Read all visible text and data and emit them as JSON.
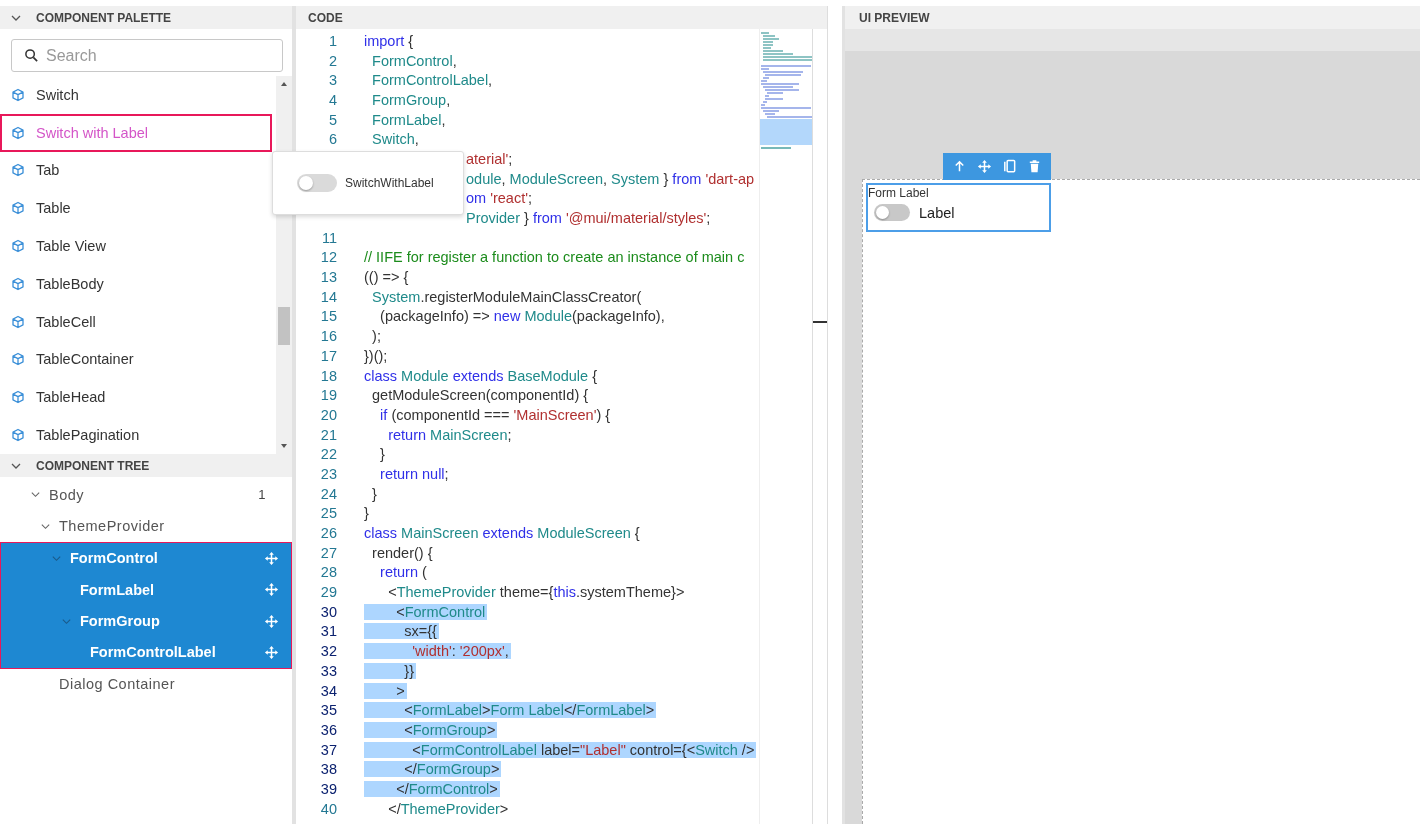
{
  "palette": {
    "title": "COMPONENT PALETTE",
    "expanded": true,
    "search": {
      "placeholder": "Search"
    },
    "items": [
      {
        "label": "Switch",
        "selected": false
      },
      {
        "label": "Switch with Label",
        "selected": true
      },
      {
        "label": "Tab",
        "selected": false
      },
      {
        "label": "Table",
        "selected": false
      },
      {
        "label": "Table View",
        "selected": false
      },
      {
        "label": "TableBody",
        "selected": false
      },
      {
        "label": "TableCell",
        "selected": false
      },
      {
        "label": "TableContainer",
        "selected": false
      },
      {
        "label": "TableHead",
        "selected": false
      },
      {
        "label": "TablePagination",
        "selected": false
      }
    ]
  },
  "drag_preview": {
    "label": "SwitchWithLabel",
    "on": false
  },
  "tree": {
    "title": "COMPONENT TREE",
    "expanded": true,
    "nodes": [
      {
        "label": "Body",
        "count": "1",
        "expanded": true,
        "selected": false,
        "children": [
          {
            "label": "ThemeProvider",
            "expanded": true,
            "selected": false,
            "children": [
              {
                "label": "FormControl",
                "expanded": true,
                "selected": true,
                "children": [
                  {
                    "label": "FormLabel",
                    "selected": true
                  },
                  {
                    "label": "FormGroup",
                    "expanded": true,
                    "selected": true,
                    "children": [
                      {
                        "label": "FormControlLabel",
                        "selected": true
                      }
                    ]
                  }
                ]
              }
            ]
          },
          {
            "label": "Dialog Container",
            "selected": false
          }
        ]
      }
    ]
  },
  "code": {
    "title": "CODE",
    "lines": [
      {
        "n": "1",
        "selected": false,
        "tokens": [
          {
            "kind": "kw",
            "t": "import"
          },
          {
            "kind": "plain",
            "t": " {"
          }
        ]
      },
      {
        "n": "2",
        "selected": false,
        "tokens": [
          {
            "kind": "type",
            "t": "  FormControl"
          },
          {
            "kind": "plain",
            "t": ","
          }
        ]
      },
      {
        "n": "3",
        "selected": false,
        "tokens": [
          {
            "kind": "type",
            "t": "  FormControlLabel"
          },
          {
            "kind": "plain",
            "t": ","
          }
        ]
      },
      {
        "n": "4",
        "selected": false,
        "tokens": [
          {
            "kind": "type",
            "t": "  FormGroup"
          },
          {
            "kind": "plain",
            "t": ","
          }
        ]
      },
      {
        "n": "5",
        "selected": false,
        "tokens": [
          {
            "kind": "type",
            "t": "  FormLabel"
          },
          {
            "kind": "plain",
            "t": ","
          }
        ]
      },
      {
        "n": "6",
        "selected": false,
        "tokens": [
          {
            "kind": "type",
            "t": "  Switch"
          },
          {
            "kind": "plain",
            "t": ","
          }
        ]
      },
      {
        "covered": true,
        "selected": false,
        "tokens": [
          {
            "kind": "str",
            "t": "aterial'"
          },
          {
            "kind": "plain",
            "t": ";"
          }
        ]
      },
      {
        "covered": true,
        "selected": false,
        "tokens": [
          {
            "kind": "type",
            "t": "odule"
          },
          {
            "kind": "plain",
            "t": ", "
          },
          {
            "kind": "type",
            "t": "ModuleScreen"
          },
          {
            "kind": "plain",
            "t": ", "
          },
          {
            "kind": "type",
            "t": "System"
          },
          {
            "kind": "plain",
            "t": " } "
          },
          {
            "kind": "kw",
            "t": "from"
          },
          {
            "kind": "str",
            "t": " 'dart-ap"
          }
        ]
      },
      {
        "covered": true,
        "selected": false,
        "tokens": [
          {
            "kind": "kw",
            "t": "om"
          },
          {
            "kind": "str",
            "t": " 'react'"
          },
          {
            "kind": "plain",
            "t": ";"
          }
        ]
      },
      {
        "covered": true,
        "selected": false,
        "tokens": [
          {
            "kind": "type",
            "t": "Provider"
          },
          {
            "kind": "plain",
            "t": " } "
          },
          {
            "kind": "kw",
            "t": "from"
          },
          {
            "kind": "str",
            "t": " '@mui/material/styles'"
          },
          {
            "kind": "plain",
            "t": ";"
          }
        ]
      },
      {
        "n": "11",
        "selected": false
      },
      {
        "n": "12",
        "selected": false,
        "tokens": [
          {
            "kind": "cmt",
            "t": "// IIFE for register a function to create an instance of main c"
          }
        ]
      },
      {
        "n": "13",
        "selected": false,
        "tokens": [
          {
            "kind": "plain",
            "t": "(() => {"
          }
        ]
      },
      {
        "n": "14",
        "selected": false,
        "tokens": [
          {
            "kind": "type",
            "t": "  System"
          },
          {
            "kind": "plain",
            "t": ".registerModuleMainClassCreator("
          }
        ]
      },
      {
        "n": "15",
        "selected": false,
        "tokens": [
          {
            "kind": "plain",
            "t": "    (packageInfo) => "
          },
          {
            "kind": "kw",
            "t": "new"
          },
          {
            "kind": "type",
            "t": " Module"
          },
          {
            "kind": "plain",
            "t": "(packageInfo),"
          }
        ]
      },
      {
        "n": "16",
        "selected": false,
        "tokens": [
          {
            "kind": "plain",
            "t": "  );"
          }
        ]
      },
      {
        "n": "17",
        "selected": false,
        "tokens": [
          {
            "kind": "plain",
            "t": "})();"
          }
        ]
      },
      {
        "n": "18",
        "selected": false,
        "tokens": [
          {
            "kind": "kw",
            "t": "class"
          },
          {
            "kind": "type",
            "t": " Module"
          },
          {
            "kind": "kw",
            "t": " extends"
          },
          {
            "kind": "type",
            "t": " BaseModule"
          },
          {
            "kind": "plain",
            "t": " {"
          }
        ]
      },
      {
        "n": "19",
        "selected": false,
        "tokens": [
          {
            "kind": "plain",
            "t": "  getModuleScreen(componentId) {"
          }
        ]
      },
      {
        "n": "20",
        "selected": false,
        "tokens": [
          {
            "kind": "kw",
            "t": "    if"
          },
          {
            "kind": "plain",
            "t": " (componentId === "
          },
          {
            "kind": "str",
            "t": "'MainScreen'"
          },
          {
            "kind": "plain",
            "t": ") {"
          }
        ]
      },
      {
        "n": "21",
        "selected": false,
        "tokens": [
          {
            "kind": "kw",
            "t": "      return"
          },
          {
            "kind": "type",
            "t": " MainScreen"
          },
          {
            "kind": "plain",
            "t": ";"
          }
        ]
      },
      {
        "n": "22",
        "selected": false,
        "tokens": [
          {
            "kind": "plain",
            "t": "    }"
          }
        ]
      },
      {
        "n": "23",
        "selected": false,
        "tokens": [
          {
            "kind": "kw",
            "t": "    return null"
          },
          {
            "kind": "plain",
            "t": ";"
          }
        ]
      },
      {
        "n": "24",
        "selected": false,
        "tokens": [
          {
            "kind": "plain",
            "t": "  }"
          }
        ]
      },
      {
        "n": "25",
        "selected": false,
        "tokens": [
          {
            "kind": "plain",
            "t": "}"
          }
        ]
      },
      {
        "n": "26",
        "selected": false,
        "tokens": [
          {
            "kind": "kw",
            "t": "class"
          },
          {
            "kind": "type",
            "t": " MainScreen"
          },
          {
            "kind": "kw",
            "t": " extends"
          },
          {
            "kind": "type",
            "t": " ModuleScreen"
          },
          {
            "kind": "plain",
            "t": " {"
          }
        ]
      },
      {
        "n": "27",
        "selected": false,
        "tokens": [
          {
            "kind": "plain",
            "t": "  render() {"
          }
        ]
      },
      {
        "n": "28",
        "selected": false,
        "tokens": [
          {
            "kind": "kw",
            "t": "    return"
          },
          {
            "kind": "plain",
            "t": " ("
          }
        ]
      },
      {
        "n": "29",
        "selected": false,
        "tokens": [
          {
            "kind": "plain",
            "t": "      <"
          },
          {
            "kind": "type",
            "t": "ThemeProvider"
          },
          {
            "kind": "plain",
            "t": " theme={"
          },
          {
            "kind": "kw",
            "t": "this"
          },
          {
            "kind": "plain",
            "t": ".systemTheme}>"
          }
        ]
      },
      {
        "n": "30",
        "selected": true,
        "tokens": [
          {
            "kind": "plain",
            "t": "        <"
          },
          {
            "kind": "type",
            "t": "FormControl"
          }
        ]
      },
      {
        "n": "31",
        "selected": true,
        "tokens": [
          {
            "kind": "plain",
            "t": "          sx={{"
          }
        ]
      },
      {
        "n": "32",
        "selected": true,
        "tokens": [
          {
            "kind": "str",
            "t": "            'width'"
          },
          {
            "kind": "plain",
            "t": ": "
          },
          {
            "kind": "str",
            "t": "'200px'"
          },
          {
            "kind": "plain",
            "t": ","
          }
        ]
      },
      {
        "n": "33",
        "selected": true,
        "tokens": [
          {
            "kind": "plain",
            "t": "          }}"
          }
        ]
      },
      {
        "n": "34",
        "selected": true,
        "tokens": [
          {
            "kind": "plain",
            "t": "        >"
          }
        ]
      },
      {
        "n": "35",
        "selected": true,
        "tokens": [
          {
            "kind": "plain",
            "t": "          <"
          },
          {
            "kind": "type",
            "t": "FormLabel"
          },
          {
            "kind": "plain",
            "t": ">"
          },
          {
            "kind": "type",
            "t": "Form Label"
          },
          {
            "kind": "plain",
            "t": "</"
          },
          {
            "kind": "type",
            "t": "FormLabel"
          },
          {
            "kind": "plain",
            "t": ">"
          }
        ]
      },
      {
        "n": "36",
        "selected": true,
        "tokens": [
          {
            "kind": "plain",
            "t": "          <"
          },
          {
            "kind": "type",
            "t": "FormGroup"
          },
          {
            "kind": "plain",
            "t": ">"
          }
        ]
      },
      {
        "n": "37",
        "selected": true,
        "tokens": [
          {
            "kind": "plain",
            "t": "            <"
          },
          {
            "kind": "type",
            "t": "FormControlLabel"
          },
          {
            "kind": "plain",
            "t": " label="
          },
          {
            "kind": "str",
            "t": "\"Label\""
          },
          {
            "kind": "plain",
            "t": " control={<"
          },
          {
            "kind": "type",
            "t": "Switch"
          },
          {
            "kind": "plain",
            "t": " />"
          }
        ]
      },
      {
        "n": "38",
        "selected": true,
        "tokens": [
          {
            "kind": "plain",
            "t": "          </"
          },
          {
            "kind": "type",
            "t": "FormGroup"
          },
          {
            "kind": "plain",
            "t": ">"
          }
        ]
      },
      {
        "n": "39",
        "selected": true,
        "tokens": [
          {
            "kind": "plain",
            "t": "        </"
          },
          {
            "kind": "type",
            "t": "FormControl"
          },
          {
            "kind": "plain",
            "t": ">"
          }
        ]
      },
      {
        "n": "40",
        "selected": false,
        "tokens": [
          {
            "kind": "plain",
            "t": "      </"
          },
          {
            "kind": "type",
            "t": "ThemeProvider"
          },
          {
            "kind": "plain",
            "t": ">"
          }
        ]
      }
    ]
  },
  "preview": {
    "title": "UI PREVIEW",
    "form_label": "Form Label",
    "switch": {
      "on": false,
      "label": "Label"
    }
  }
}
